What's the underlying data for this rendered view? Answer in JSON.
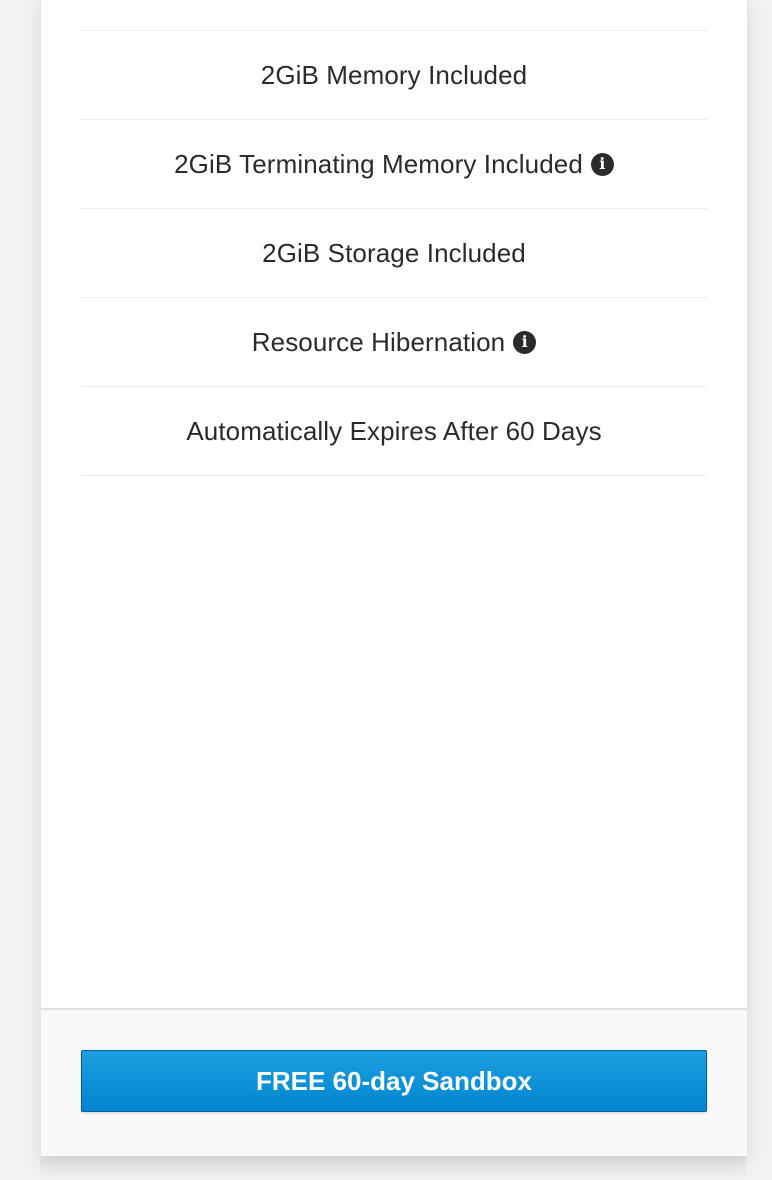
{
  "features": {
    "items": [
      {
        "label": "2GiB Memory Included",
        "has_info": false
      },
      {
        "label": "2GiB Terminating Memory Included",
        "has_info": true
      },
      {
        "label": "2GiB Storage Included",
        "has_info": false
      },
      {
        "label": "Resource Hibernation",
        "has_info": true
      },
      {
        "label": "Automatically Expires After 60 Days",
        "has_info": false
      }
    ]
  },
  "icons": {
    "info": "i"
  },
  "cta": {
    "label": "FREE 60-day Sandbox"
  },
  "colors": {
    "cta_background": "#0a93d9",
    "text": "#2b2b2b"
  }
}
